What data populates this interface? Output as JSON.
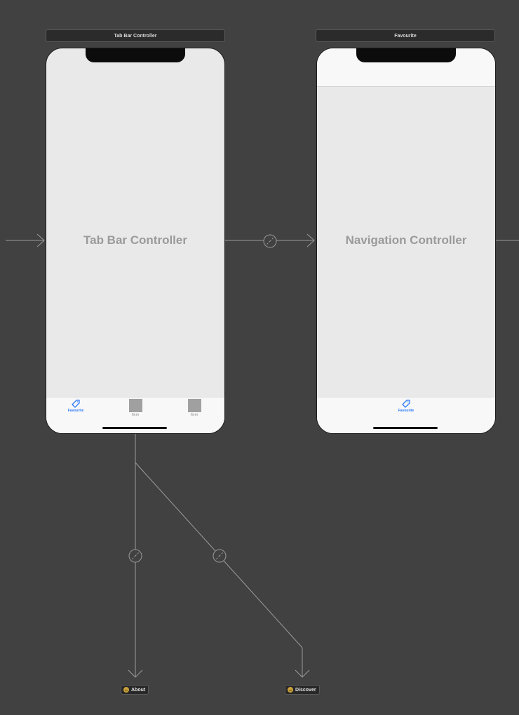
{
  "scenes": {
    "tab_bar_controller": {
      "title": "Tab Bar Controller",
      "placeholder": "Tab Bar Controller",
      "tabs": [
        {
          "label": "Favourite",
          "icon": "tag-icon",
          "active": true
        },
        {
          "label": "Item",
          "icon": "placeholder-icon",
          "active": false
        },
        {
          "label": "Item",
          "icon": "placeholder-icon",
          "active": false
        }
      ]
    },
    "navigation_controller": {
      "title": "Favourite",
      "placeholder": "Navigation Controller",
      "tabs": [
        {
          "label": "Favourite",
          "icon": "tag-icon",
          "active": true
        }
      ]
    }
  },
  "storyboard_references": [
    {
      "label": "About",
      "icon": "storyboard-reference-icon"
    },
    {
      "label": "Discover",
      "icon": "storyboard-reference-icon"
    }
  ],
  "colors": {
    "canvas": "#414141",
    "scene_background": "#e9e9e9",
    "tab_active": "#2f7cf6",
    "connector": "#9a9a9a",
    "reference_icon": "#c9a23a"
  }
}
